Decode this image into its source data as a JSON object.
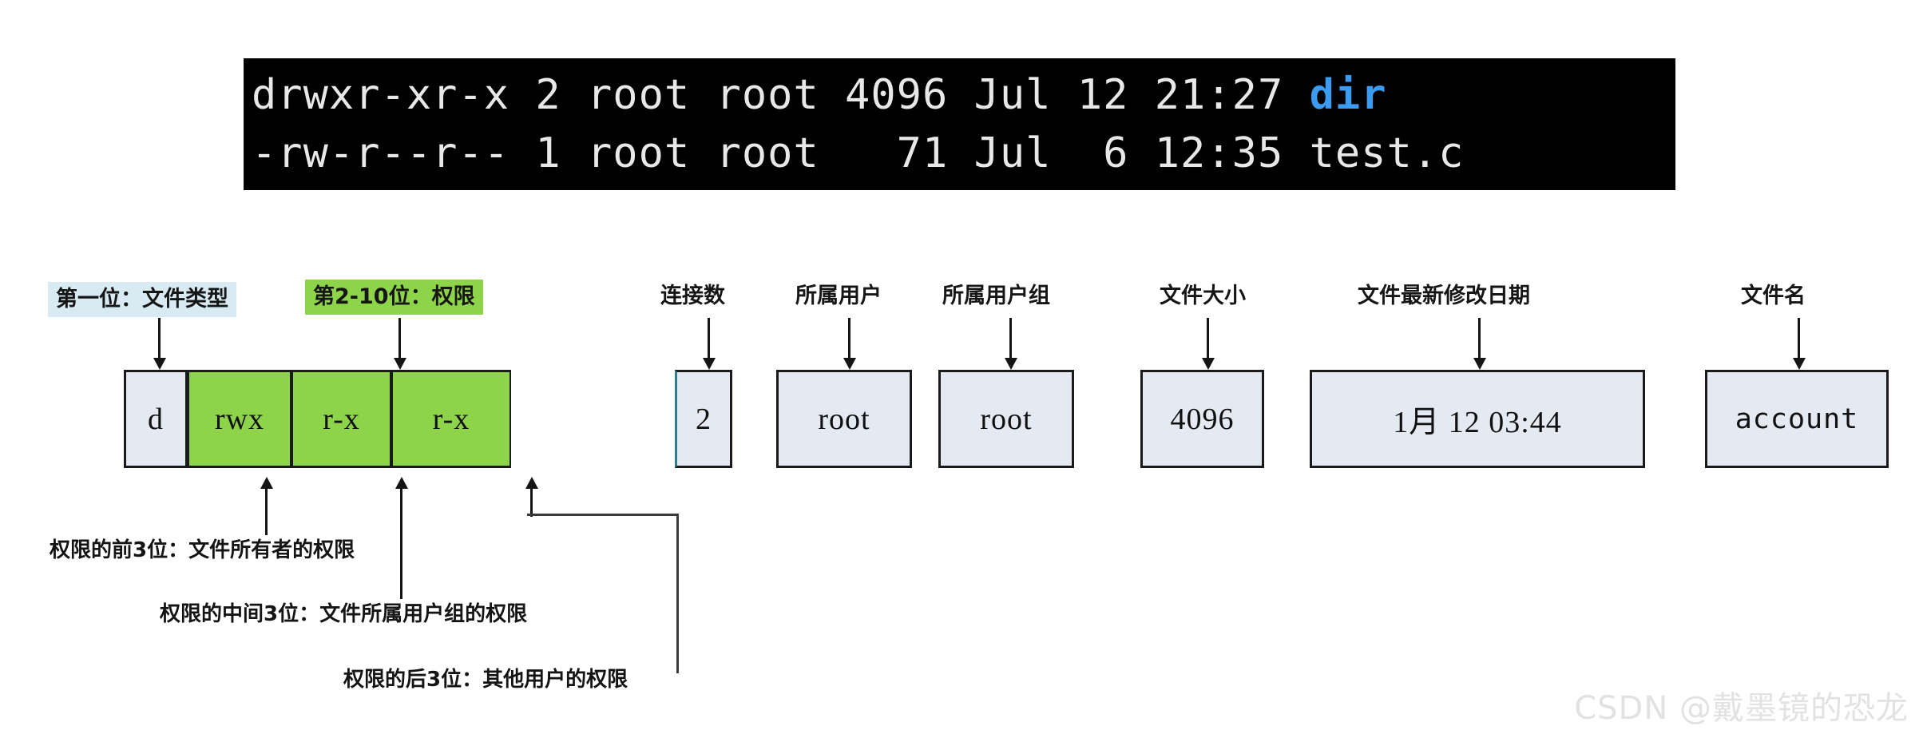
{
  "terminal": {
    "line1_prefix": "drwxr-xr-x 2 root root 4096 Jul 12 21:27 ",
    "line1_name": "dir",
    "line2": "-rw-r--r-- 1 root root   71 Jul  6 12:35 test.c",
    "dir_color": "#3b9bf0",
    "background": "#000000",
    "text_color": "#e8e8e8"
  },
  "headers": {
    "file_type": "第一位：文件类型",
    "permissions": "第2-10位：权限",
    "link_count": "连接数",
    "owner": "所属用户",
    "group": "所属用户组",
    "size": "文件大小",
    "mtime": "文件最新修改日期",
    "filename": "文件名",
    "file_type_bg": "#d8eaf2",
    "permissions_bg": "#8ed44a"
  },
  "boxes": {
    "file_type": "d",
    "perm_owner": "rwx",
    "perm_group": "r-x",
    "perm_other": "r-x",
    "link_count": "2",
    "owner": "root",
    "group": "root",
    "size": "4096",
    "mtime": "1月  12 03:44",
    "filename": "account",
    "neutral_bg": "#e4e9f2",
    "permission_bg": "#8ed44a"
  },
  "annotations": {
    "owner_bits": "权限的前3位：文件所有者的权限",
    "group_bits": "权限的中间3位：文件所属用户组的权限",
    "other_bits": "权限的后3位：其他用户的权限"
  },
  "watermark": "CSDN @戴墨镜的恐龙"
}
